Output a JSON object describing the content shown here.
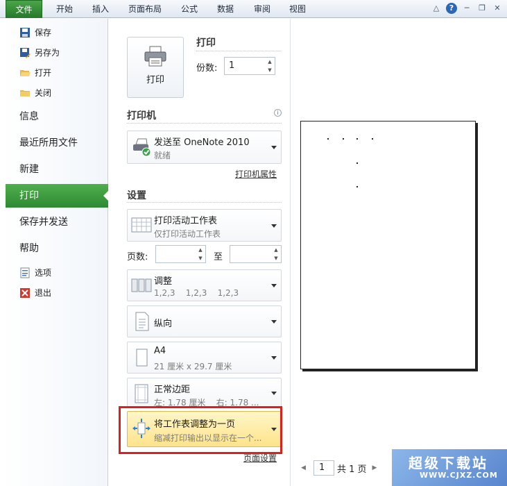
{
  "ribbon": {
    "tabs": [
      "文件",
      "开始",
      "插入",
      "页面布局",
      "公式",
      "数据",
      "审阅",
      "视图"
    ]
  },
  "nav": {
    "commands_top": [
      {
        "label": "保存",
        "icon": "save-icon"
      },
      {
        "label": "另存为",
        "icon": "save-as-icon"
      },
      {
        "label": "打开",
        "icon": "open-folder-icon"
      },
      {
        "label": "关闭",
        "icon": "close-folder-icon"
      }
    ],
    "items": [
      "信息",
      "最近所用文件",
      "新建",
      "打印",
      "保存并发送",
      "帮助"
    ],
    "active": "打印",
    "commands_bottom": [
      {
        "label": "选项",
        "icon": "options-icon"
      },
      {
        "label": "退出",
        "icon": "exit-icon"
      }
    ]
  },
  "print": {
    "section_title": "打印",
    "button_label": "打印",
    "copies_label": "份数:",
    "copies_value": "1"
  },
  "printer": {
    "section_title": "打印机",
    "name": "发送至 OneNote 2010",
    "status": "就绪",
    "properties_link": "打印机属性"
  },
  "settings": {
    "section_title": "设置",
    "what": {
      "title": "打印活动工作表",
      "sub": "仅打印活动工作表"
    },
    "pages_label": "页数:",
    "pages_from": "",
    "to_label": "至",
    "pages_to": "",
    "collate": {
      "title": "调整",
      "sub": "1,2,3    1,2,3    1,2,3"
    },
    "orientation": {
      "title": "纵向"
    },
    "paper": {
      "title": "A4",
      "sub": "21 厘米 x 29.7 厘米"
    },
    "margins": {
      "title": "正常边距",
      "sub": "左: 1.78 厘米    右: 1.78 ..."
    },
    "scaling": {
      "title": "将工作表调整为一页",
      "sub": "缩减打印输出以显示在一个..."
    },
    "page_setup_link": "页面设置"
  },
  "preview": {
    "current_page": "1",
    "total_label": "共 1 页"
  },
  "watermark": {
    "line1": "超级下载站",
    "line2": "WWW.CJXZ.COM"
  }
}
